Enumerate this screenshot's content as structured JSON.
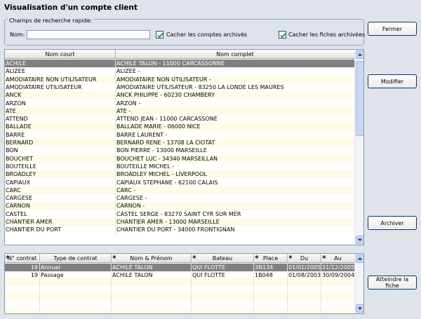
{
  "window": {
    "title": "Visualisation d'un compte client"
  },
  "search": {
    "legend": "Champs de recherche rapide:",
    "name_label": "Nom:",
    "name_value": "",
    "hide_archived_accounts_label": "Cacher les comptes archivés",
    "hide_archived_accounts_checked": true,
    "hide_archived_files_label": "Cacher les fiches archivées",
    "hide_archived_files_checked": true
  },
  "buttons": {
    "close": "Fermer",
    "modify": "Modifier",
    "archive": "Archiver",
    "goto_file": "Atteindre la fiche"
  },
  "clients": {
    "columns": [
      "Nom court",
      "Nom complet"
    ],
    "rows": [
      [
        "ACHILE",
        "ACHILE TALON - 11000 CARCASSONNE"
      ],
      [
        "ALIZEE",
        "ALIZEE -"
      ],
      [
        "AMODIATAIRE NON UTILISATEUR",
        "AMODIATAIRE NON UTILISATEUR -"
      ],
      [
        "AMODIATAIRE UTILISATEUR",
        "AMODIATAIRE UTILISATEUR - 83250 LA LONDE LES MAURES"
      ],
      [
        "ANCK",
        "ANCK PHILIPPE - 60230 CHAMBERY"
      ],
      [
        "ARZON",
        "ARZON -"
      ],
      [
        "ATE",
        "ATE -"
      ],
      [
        "ATTEND",
        "ATTEND JEAN - 11000 CARCASSONE"
      ],
      [
        "BALLADE",
        "BALLADE MARIE - 06000 NICE"
      ],
      [
        "BARRE",
        "BARRE LAURENT -"
      ],
      [
        "BERNARD",
        "BERNARD RENE - 13708 LA CIOTAT"
      ],
      [
        "BON",
        "BON PIERRE - 13000 MARSEILLE"
      ],
      [
        "BOUCHET",
        "BOUCHET LUC - 34340 MARSEILLAN"
      ],
      [
        "BOUTEILLE",
        "BOUTEILLE MICHEL -"
      ],
      [
        "BROADLEY",
        "BROADLEY MICHEL - LIVERPOOL"
      ],
      [
        "CAPIAUX",
        "CAPIAUX STEPHANE - 62100 CALAIS"
      ],
      [
        "CARC",
        "CARC -"
      ],
      [
        "CARGESE",
        "CARGESE -"
      ],
      [
        "CARNON",
        "CARNON -"
      ],
      [
        "CASTEL",
        "CASTEL SERGE - 83270 SAINT CYR SUR MER"
      ],
      [
        "CHANTIER AMER",
        "CHANTIER AMER - 13000 MARSEILLE"
      ],
      [
        "CHANTIER DU PORT",
        "CHANTIER DU PORT - 34000 FRONTIGNAN"
      ]
    ]
  },
  "contracts": {
    "columns": [
      "N° contrat",
      "Type de contrat",
      "Nom & Prénom",
      "Bateau",
      "Place",
      "Du",
      "Au"
    ],
    "rows": [
      [
        "19",
        "Annuel",
        "ACHILE TALON",
        "QUI FLOTTE",
        "3N134",
        "01/01/2005",
        "31/12/2005"
      ],
      [
        "19",
        "Passage",
        "ACHILE TALON",
        "QUI FLOTTE",
        "1B048",
        "01/08/2003",
        "30/09/2004"
      ]
    ]
  },
  "icons": {
    "checkbox_checked": "check-icon",
    "scroll_up": "arrow-up-icon",
    "scroll_down": "arrow-down-icon",
    "column_marker": "asterisk-icon"
  },
  "colors": {
    "background": "#dfe3ea",
    "selected_row": "#808080",
    "alt_row": "#fffce6",
    "check": "#21a121"
  }
}
